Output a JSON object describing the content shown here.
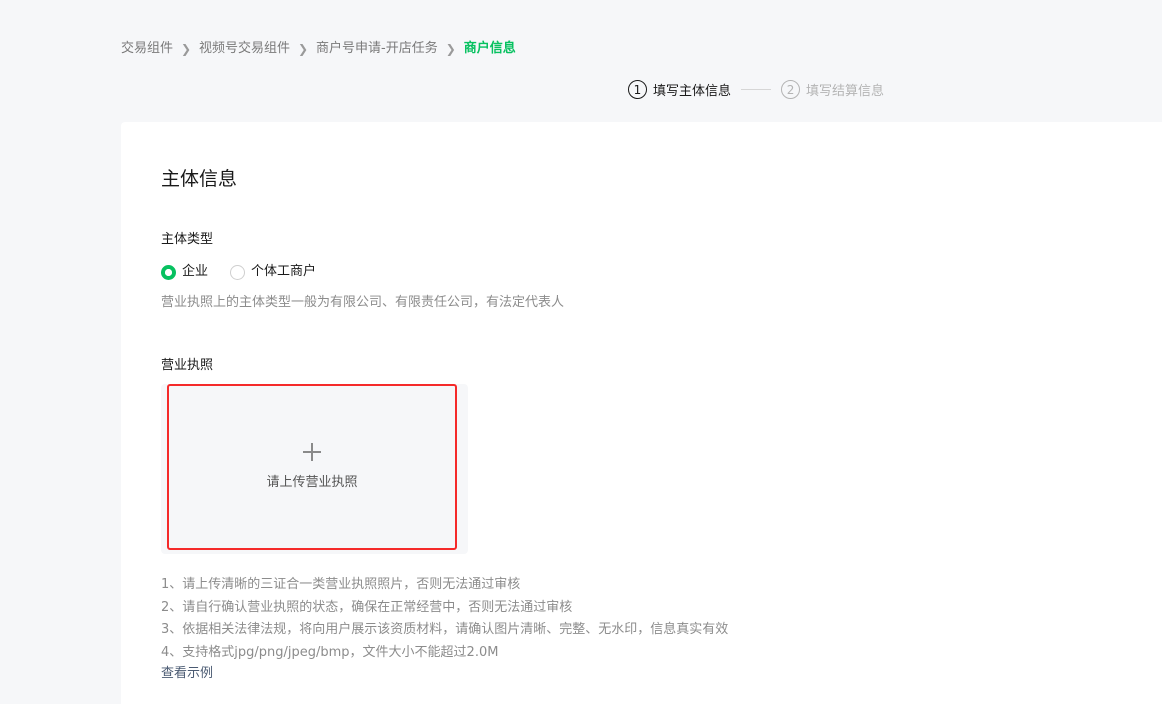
{
  "breadcrumb": {
    "items": [
      "交易组件",
      "视频号交易组件",
      "商户号申请-开店任务",
      "商户信息"
    ],
    "separator": ">"
  },
  "steps": [
    {
      "num": "1",
      "label": "填写主体信息",
      "state": "active"
    },
    {
      "num": "2",
      "label": "填写结算信息",
      "state": "inactive"
    }
  ],
  "section": {
    "title": "主体信息",
    "subject_type_label": "主体类型",
    "options": [
      {
        "label": "企业",
        "checked": true
      },
      {
        "label": "个体工商户",
        "checked": false
      }
    ],
    "hint": "营业执照上的主体类型一般为有限公司、有限责任公司，有法定代表人",
    "license_label": "营业执照",
    "upload_text": "请上传营业执照",
    "notes": [
      "1、请上传清晰的三证合一类营业执照照片，否则无法通过审核",
      "2、请自行确认营业执照的状态，确保在正常经营中，否则无法通过审核",
      "3、依据相关法律法规，将向用户展示该资质材料，请确认图片清晰、完整、无水印，信息真实有效",
      "4、支持格式jpg/png/jpeg/bmp，文件大小不能超过2.0M"
    ],
    "example_link": "查看示例"
  },
  "colors": {
    "accent": "#07c160",
    "highlight_border": "#f52a2a"
  }
}
